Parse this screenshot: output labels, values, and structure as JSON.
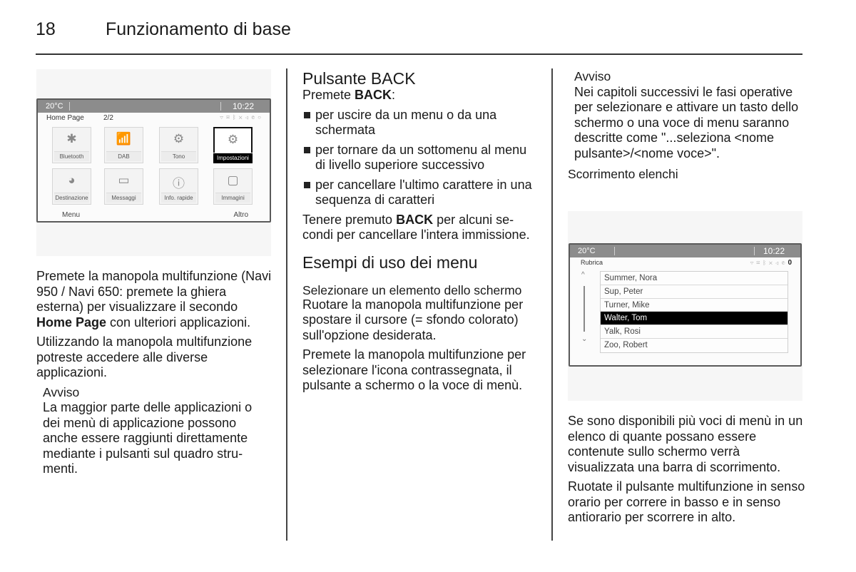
{
  "header": {
    "page_number": "18",
    "title": "Funzionamento di base"
  },
  "column1": {
    "figure": {
      "status_bar": {
        "temperature": "20°C",
        "time": "10:22"
      },
      "screen_title": "Home Page",
      "page_indicator": "2/2",
      "status_icons": [
        "wifi-icon",
        "message-icon",
        "bluetooth-icon",
        "shuffle-icon",
        "mute-icon",
        "phone-icon",
        "info-icon"
      ],
      "tiles": [
        {
          "label": "Bluetooth",
          "icon": "bluetooth-icon",
          "glyph": "✱",
          "selected": false
        },
        {
          "label": "DAB",
          "icon": "dab-radio-icon",
          "glyph": "📶",
          "selected": false
        },
        {
          "label": "Tono",
          "icon": "tone-settings-icon",
          "glyph": "⚙",
          "selected": false
        },
        {
          "label": "Impostazioni",
          "icon": "settings-gears-icon",
          "glyph": "⚙",
          "selected": true
        },
        {
          "label": "Destinazione",
          "icon": "destination-globe-icon",
          "glyph": "◕",
          "selected": false
        },
        {
          "label": "Messaggi",
          "icon": "messages-icon",
          "glyph": "▭",
          "selected": false
        },
        {
          "label": "Info. rapide",
          "icon": "info-icon",
          "glyph": "ⓘ",
          "selected": false
        },
        {
          "label": "Immagini",
          "icon": "pictures-icon",
          "glyph": "▢",
          "selected": false
        }
      ],
      "softkeys": {
        "left": "Menu",
        "right": "Altro"
      }
    },
    "para1": {
      "before": "Premete la manopola multifunzione (Navi 950 / Navi 650: premete la ghiera esterna) per visualizzare il se­condo ",
      "bold": "Home Page",
      "after": " con ulteriori appli­cazioni."
    },
    "para2": "Utilizzando la manopola multifun­zione potreste accedere alle diverse applicazioni.",
    "notice": {
      "title": "Avviso",
      "text": "La maggior parte delle applicazioni o dei menù di applicazione possono anche essere raggiunti direttamente mediante i pulsanti sul quadro stru­menti."
    }
  },
  "column2": {
    "heading_back": "Pulsante BACK",
    "intro": {
      "before": "Premete ",
      "bold": "BACK",
      "after": ":"
    },
    "bullets": [
      "per uscire da un menu o da una schermata",
      "per tornare da un sottomenu al menu di livello superiore succes­sivo",
      "per cancellare l'ultimo carattere in una sequenza di caratteri"
    ],
    "hold_para": {
      "before": "Tenere premuto ",
      "bold": "BACK",
      "after": " per alcuni se­condi per cancellare l'intera immis­sione."
    },
    "heading_examples": "Esempi di uso dei menu",
    "subheading_select": "Selezionare un elemento dello schermo",
    "para_rotate": "Ruotare la manopola multifunzione per spostare il cursore (= sfondo co­lorato) sull'opzione desiderata.",
    "para_press": "Premete la manopola multifunzione per selezionare l'icona contrasse­gnata, il pulsante a schermo o la voce di menù."
  },
  "column3": {
    "notice": {
      "title": "Avviso",
      "text": "Nei capitoli successivi le fasi opera­tive per selezionare e attivare un ta­sto dello schermo o una voce di menu saranno descritte come \"...se­leziona <nome pulsante>/<nome voce>\"."
    },
    "subheading_scroll": "Scorrimento elenchi",
    "figure": {
      "status_bar": {
        "temperature": "20°C",
        "time": "10:22"
      },
      "screen_title": "Rubrica",
      "contacts": [
        {
          "name": "Summer, Nora",
          "selected": false
        },
        {
          "name": "Sup, Peter",
          "selected": false
        },
        {
          "name": "Turner, Mike",
          "selected": false
        },
        {
          "name": "Walter, Tom",
          "selected": true
        },
        {
          "name": "Yalk, Rosi",
          "selected": false
        },
        {
          "name": "Zoo, Robert",
          "selected": false
        }
      ],
      "scroll_up_glyph": "^",
      "scroll_down_glyph": "⌄"
    },
    "para_scrollbar": "Se sono disponibili più voci di menù in un elenco di quante possano es­sere contenute sullo schermo verrà visualizzata una barra di scorrimento.",
    "para_rotate": "Ruotate il pulsante multifunzione in senso orario per correre in basso e in senso antiorario per scorrere in alto."
  }
}
